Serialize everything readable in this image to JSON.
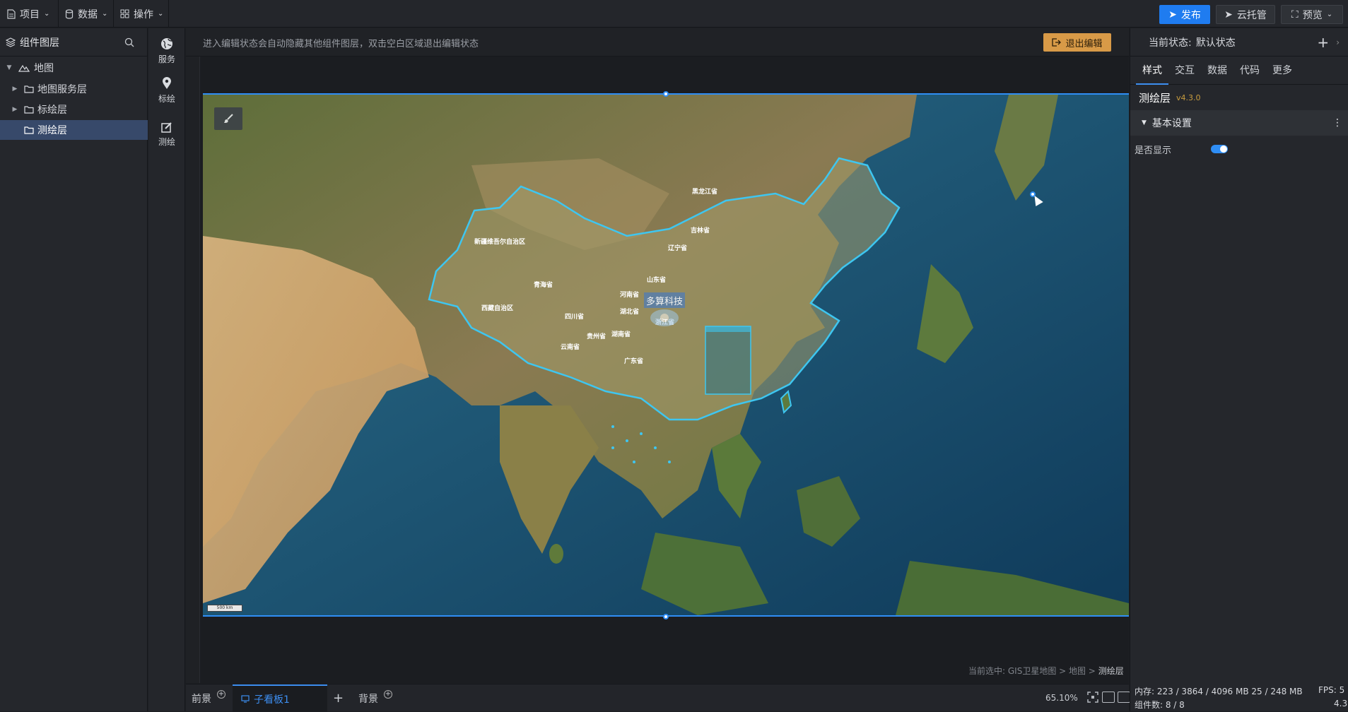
{
  "topbar": {
    "menus": [
      {
        "label": "项目",
        "icon": "document-icon"
      },
      {
        "label": "数据",
        "icon": "database-icon"
      },
      {
        "label": "操作",
        "icon": "grid-icon"
      }
    ],
    "publish_label": "发布",
    "cloud_label": "云托管",
    "preview_label": "预览",
    "accent": "#1f7cf0"
  },
  "left_panel": {
    "title": "组件图层",
    "tree": [
      {
        "label": "地图",
        "level": 0,
        "expanded": true,
        "icon": "map-icon"
      },
      {
        "label": "地图服务层",
        "level": 1,
        "expanded": false,
        "icon": "folder-icon"
      },
      {
        "label": "标绘层",
        "level": 1,
        "expanded": false,
        "icon": "folder-icon"
      },
      {
        "label": "测绘层",
        "level": 1,
        "selected": true,
        "icon": "folder-icon"
      }
    ]
  },
  "tools": [
    {
      "label": "服务",
      "icon": "globe-icon"
    },
    {
      "label": "标绘",
      "icon": "pin-icon"
    },
    {
      "label": "测绘",
      "icon": "draw-icon"
    }
  ],
  "canvas": {
    "info_message": "进入编辑状态会自动隐藏其他组件图层，双击空白区域退出编辑状态",
    "exit_label": "退出编辑",
    "exit_color": "#d89a47",
    "map_label": "多算科技",
    "scale_text": "500 km",
    "breadcrumb_prefix": "当前选中: GIS卫星地图 > 地图 > ",
    "breadcrumb_current": "测绘层",
    "province_labels": [
      "黑龙江省",
      "吉林省",
      "辽宁省",
      "新疆维吾尔自治区",
      "山东省",
      "青海省",
      "河南省",
      "西藏自治区",
      "湖北省",
      "四川省",
      "贵州省",
      "湖南省",
      "云南省",
      "广东省",
      "浙江省"
    ]
  },
  "bottom": {
    "tabs": [
      "前景",
      "子看板1",
      "背景"
    ],
    "active_tab": "子看板1",
    "add_label": "+",
    "zoom": "65.10%"
  },
  "right_panel": {
    "state_label": "当前状态:",
    "state_value": "默认状态",
    "tabs": [
      "样式",
      "交互",
      "数据",
      "代码",
      "更多"
    ],
    "active_tab": "样式",
    "layer_name": "测绘层",
    "layer_version": "v4.3.0",
    "section_title": "基本设置",
    "field_label": "是否显示",
    "field_on": true,
    "memory": "内存:  223 / 3864 / 4096 MB  25 / 248 MB",
    "fps": "FPS: 5",
    "components": "组件数: 8 / 8",
    "version_footer": "4.3."
  }
}
